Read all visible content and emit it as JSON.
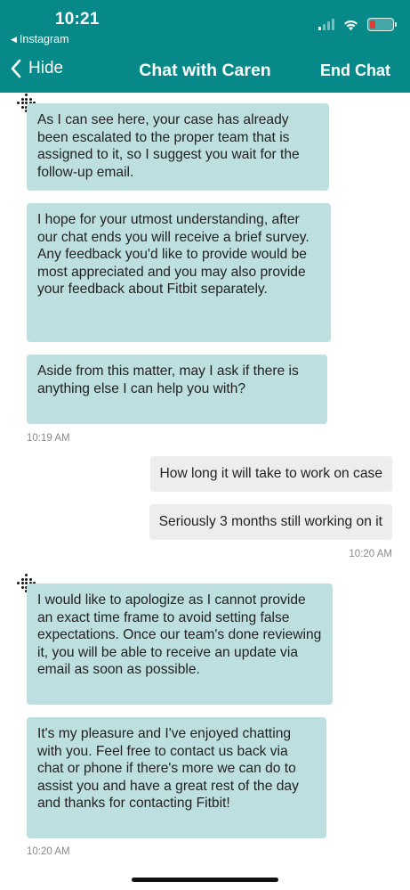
{
  "status_bar": {
    "time": "10:21",
    "back_app": "Instagram",
    "back_arrow": "◀"
  },
  "nav": {
    "back_label": "Hide",
    "title": "Chat with Caren",
    "end_chat": "End Chat"
  },
  "colors": {
    "header": "#07898a",
    "agent_bubble": "#bedfe0",
    "user_bubble": "#ededed",
    "battery_low": "#e23b2e"
  },
  "icons": {
    "back": "chevron-left-icon",
    "agent_avatar": "fitbit-logo-icon",
    "wifi": "wifi-icon",
    "signal": "cellular-signal-icon",
    "battery": "battery-icon"
  },
  "messages": {
    "agent_1": "As I can see here, your case has already been escalated to the proper team that is assigned to it, so I suggest you wait for the follow-up email.",
    "agent_2": "I hope for your utmost understanding, after our chat ends you will receive a brief survey. Any feedback you'd like to provide would be most appreciated and you may also provide your feedback about Fitbit separately.",
    "agent_3": "Aside from this matter, may I ask if there is anything else I can help you with?",
    "time_1": "10:19 AM",
    "user_1": "How long it will take to work on case",
    "user_2": "Seriously 3 months still working on it",
    "time_2": "10:20 AM",
    "agent_4": "I would like to apologize as I cannot provide an exact time frame to avoid setting false expectations. Once our team's done reviewing it, you will be able to receive an update via email as soon as possible.",
    "agent_5": "It's my pleasure and I've enjoyed chatting with you. Feel free to contact us back via chat or phone if there's more we can do to assist you and have a great rest of the day and thanks for contacting Fitbit!",
    "time_3": "10:20 AM"
  }
}
